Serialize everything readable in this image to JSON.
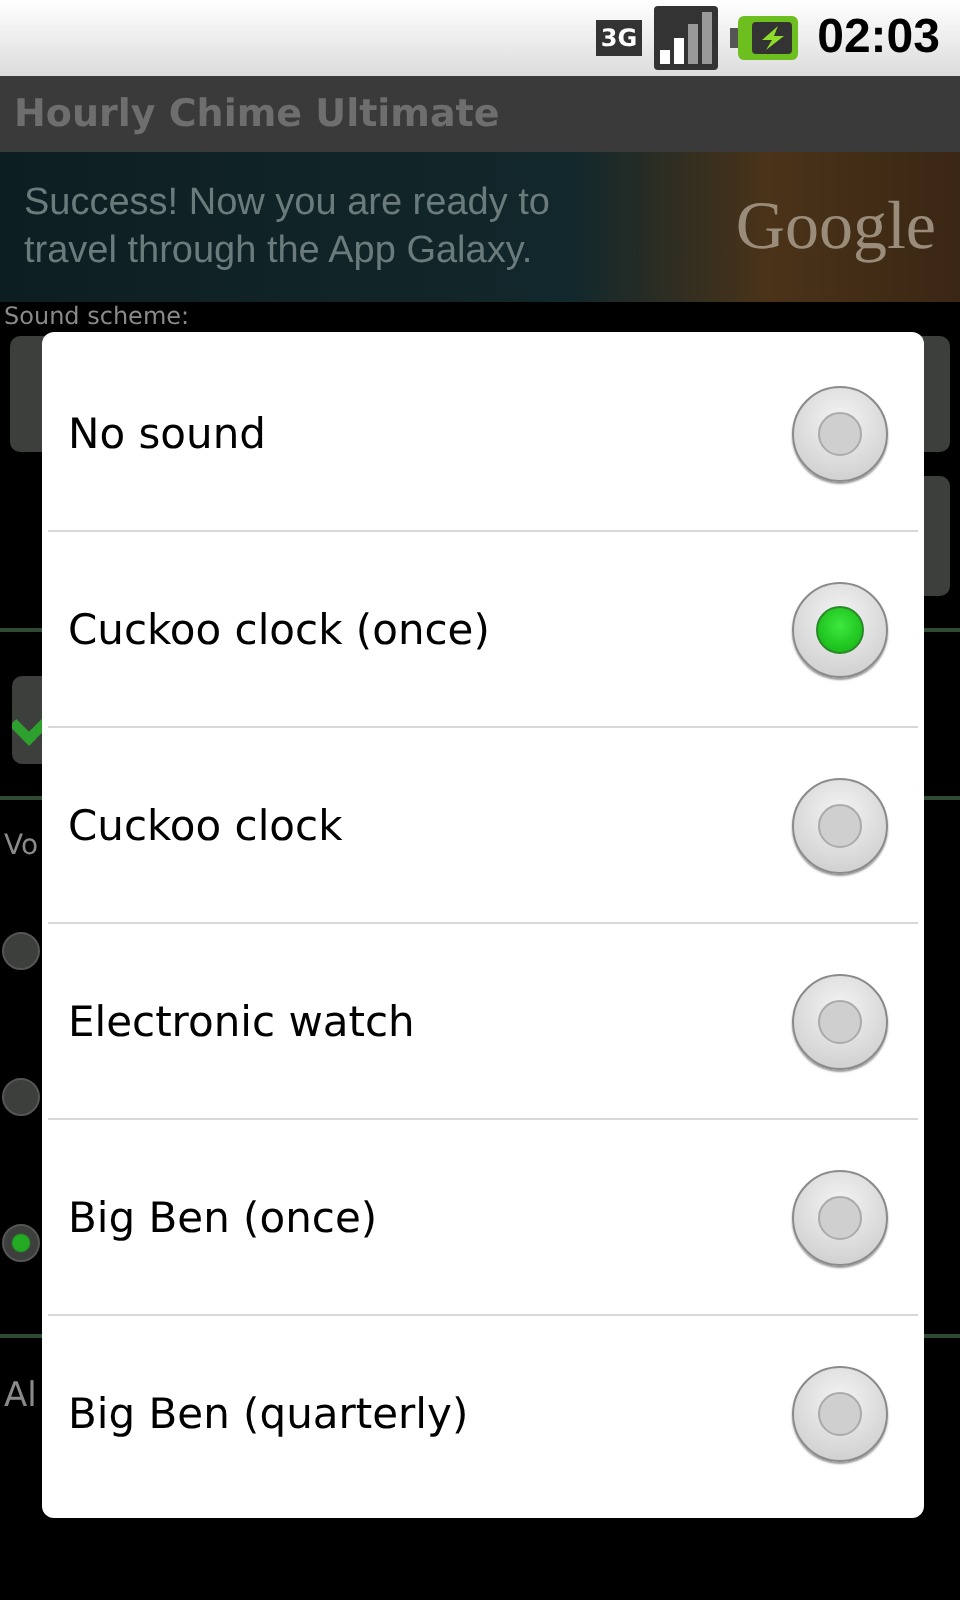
{
  "status_bar": {
    "network": "3G",
    "time": "02:03"
  },
  "app_title": "Hourly Chime Ultimate",
  "ad": {
    "text": "Success! Now you are ready to travel through the App Galaxy.",
    "logo": "Google"
  },
  "background": {
    "sound_scheme_label": "Sound scheme:",
    "checkbox": {
      "checked": true
    },
    "volume_label": "Vo",
    "radios": [
      {
        "selected": false
      },
      {
        "selected": false
      },
      {
        "selected": true
      }
    ],
    "alarm_label": "Al"
  },
  "dialog": {
    "options": [
      {
        "label": "No sound",
        "selected": false
      },
      {
        "label": "Cuckoo clock (once)",
        "selected": true
      },
      {
        "label": "Cuckoo clock",
        "selected": false
      },
      {
        "label": "Electronic watch",
        "selected": false
      },
      {
        "label": "Big Ben (once)",
        "selected": false
      },
      {
        "label": "Big Ben (quarterly)",
        "selected": false
      }
    ]
  }
}
